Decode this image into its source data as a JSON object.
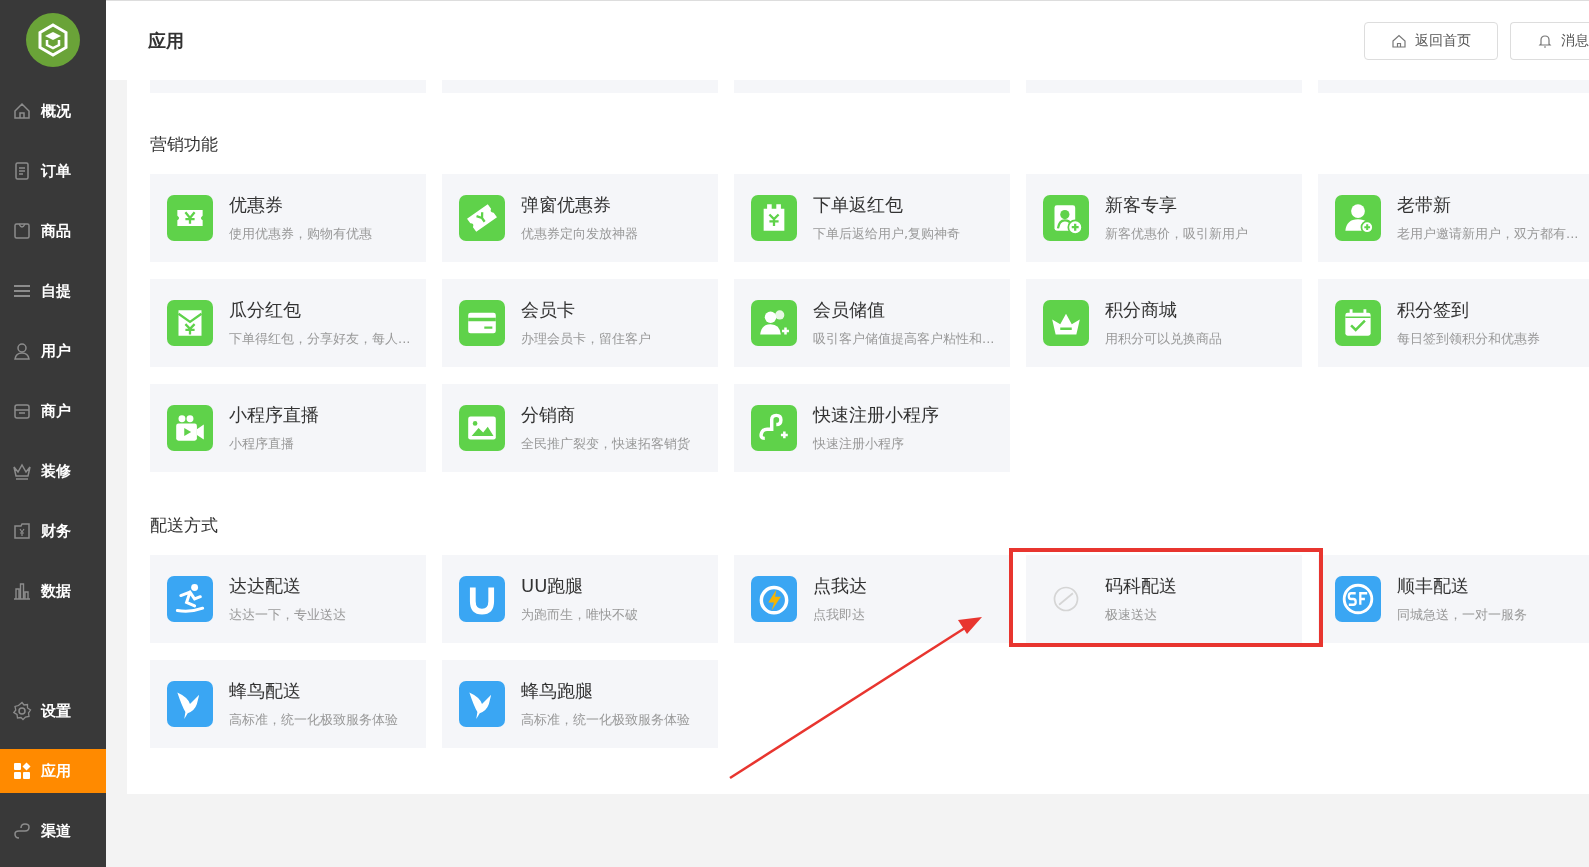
{
  "sidebar": {
    "items": [
      {
        "label": "概况",
        "selected": false
      },
      {
        "label": "订单",
        "selected": false
      },
      {
        "label": "商品",
        "selected": false
      },
      {
        "label": "自提",
        "selected": false
      },
      {
        "label": "用户",
        "selected": false
      },
      {
        "label": "商户",
        "selected": false
      },
      {
        "label": "装修",
        "selected": false
      },
      {
        "label": "财务",
        "selected": false
      },
      {
        "label": "数据",
        "selected": false
      }
    ],
    "bottom_items": [
      {
        "label": "设置",
        "selected": false
      },
      {
        "label": "应用",
        "selected": true
      },
      {
        "label": "渠道",
        "selected": false
      }
    ]
  },
  "header": {
    "title": "应用",
    "buttons": [
      "返回首页",
      "消息"
    ]
  },
  "sections": [
    {
      "title": "营销功能",
      "color": "#5fd24a",
      "items": [
        {
          "name": "优惠券",
          "desc": "使用优惠券，购物有优惠",
          "highlighted": false
        },
        {
          "name": "弹窗优惠券",
          "desc": "优惠券定向发放神器",
          "highlighted": false
        },
        {
          "name": "下单返红包",
          "desc": "下单后返给用户,复购神奇",
          "highlighted": false
        },
        {
          "name": "新客专享",
          "desc": "新客优惠价，吸引新用户",
          "highlighted": false
        },
        {
          "name": "老带新",
          "desc": "老用户邀请新用户，双方都有...",
          "highlighted": false
        },
        {
          "name": "瓜分红包",
          "desc": "下单得红包，分享好友，每人...",
          "highlighted": false
        },
        {
          "name": "会员卡",
          "desc": "办理会员卡，留住客户",
          "highlighted": false
        },
        {
          "name": "会员储值",
          "desc": "吸引客户储值提高客户粘性和...",
          "highlighted": false
        },
        {
          "name": "积分商城",
          "desc": "用积分可以兑换商品",
          "highlighted": false
        },
        {
          "name": "积分签到",
          "desc": "每日签到领积分和优惠券",
          "highlighted": false
        },
        {
          "name": "小程序直播",
          "desc": "小程序直播",
          "highlighted": false
        },
        {
          "name": "分销商",
          "desc": "全民推广裂变，快速拓客销货",
          "highlighted": false
        },
        {
          "name": "快速注册小程序",
          "desc": "快速注册小程序",
          "highlighted": false
        }
      ]
    },
    {
      "title": "配送方式",
      "color": "#3aa6f3",
      "items": [
        {
          "name": "达达配送",
          "desc": "达达一下，专业送达",
          "highlighted": false
        },
        {
          "name": "UU跑腿",
          "desc": "为跑而生，唯快不破",
          "highlighted": false
        },
        {
          "name": "点我达",
          "desc": "点我即达",
          "highlighted": false
        },
        {
          "name": "码科配送",
          "desc": "极速送达",
          "highlighted": true
        },
        {
          "name": "顺丰配送",
          "desc": "同城急送，一对一服务",
          "highlighted": false
        },
        {
          "name": "蜂鸟配送",
          "desc": "高标准，统一化极致服务体验",
          "highlighted": false
        },
        {
          "name": "蜂鸟跑腿",
          "desc": "高标准，统一化极致服务体验",
          "highlighted": false
        }
      ]
    }
  ]
}
